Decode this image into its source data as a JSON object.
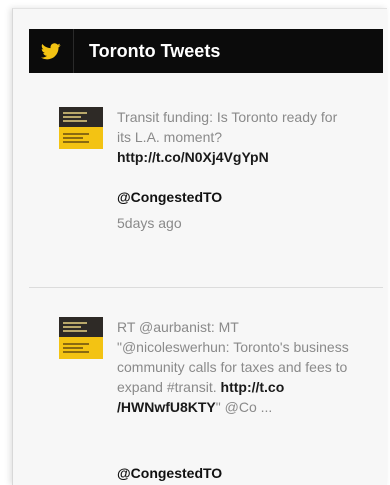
{
  "header": {
    "title": "Toronto Tweets",
    "icon": "twitter-bird-icon",
    "accent": "#f3c313"
  },
  "tweets": [
    {
      "text": "Transit funding: Is Toronto ready for its L.A. moment?",
      "link": "http://t.co/N0Xj4VgYpN",
      "handle": "@CongestedTO",
      "time": "5days ago"
    },
    {
      "text_before": "RT @aurbanist: MT \"@nicoleswerhun: Toronto's business community calls for taxes and fees to expand #transit. ",
      "link": "http://t.co /HWNwfU8KTY",
      "text_after": "\" @Co ...",
      "handle": "@CongestedTO"
    }
  ]
}
